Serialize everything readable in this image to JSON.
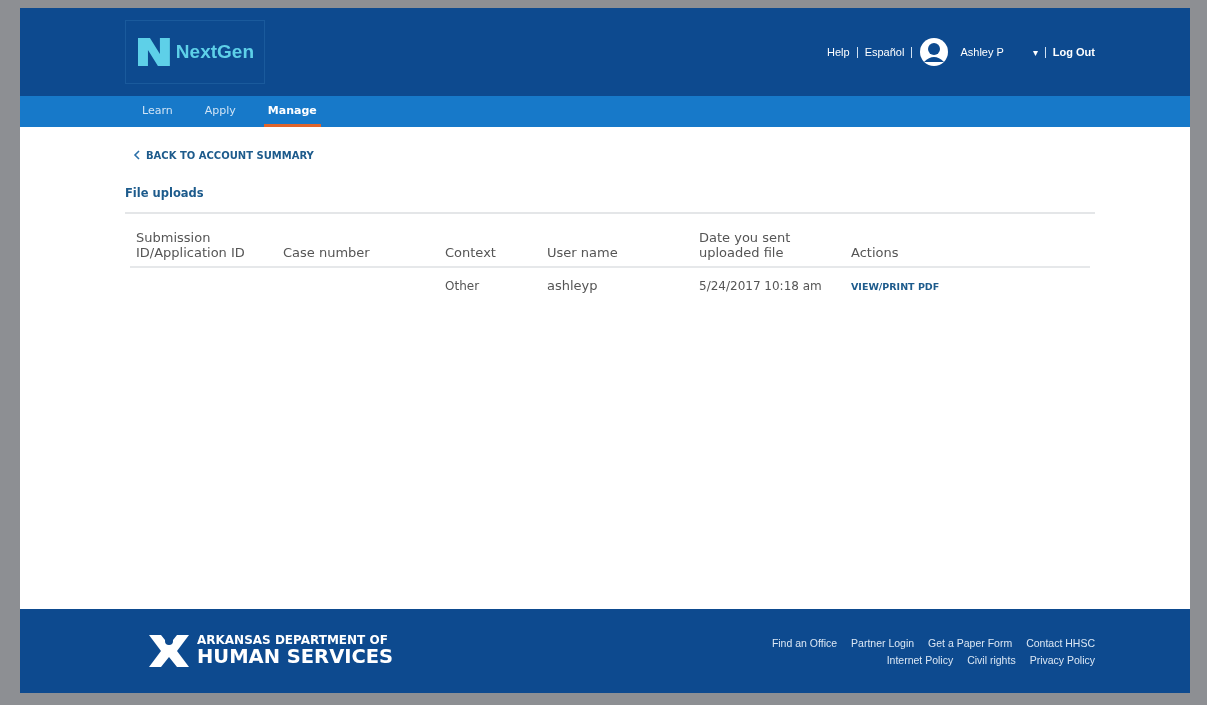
{
  "header": {
    "logo_text": "NextGen",
    "links": [
      "Help",
      "Español"
    ],
    "user": "Ashley P",
    "caret": "▾",
    "logout": "Log Out"
  },
  "nav": [
    {
      "label": "Learn",
      "selected": false
    },
    {
      "label": "Apply",
      "selected": false
    },
    {
      "label": "Manage",
      "selected": true
    }
  ],
  "back_link": "BACK TO ACCOUNT SUMMARY",
  "section_title": "File uploads",
  "table": {
    "columns": [
      "Submission ID/Application ID",
      "Case number",
      "Context",
      "User name",
      "Date you sent uploaded file",
      "Actions"
    ],
    "rows": [
      {
        "context": "Other",
        "user_name": "ashleyp",
        "date": "5/24/2017 10:18 am",
        "action": "VIEW/PRINT PDF"
      }
    ]
  },
  "footer": {
    "logo_line1": "ARKANSAS DEPARTMENT OF",
    "logo_line2": "HUMAN SERVICES",
    "links_row1": [
      "Find an Office",
      "Partner Login",
      "Get a Paper Form",
      "Contact HHSC"
    ],
    "links_row2": [
      "Internet Policy",
      "Civil rights",
      "Privacy Policy"
    ]
  }
}
